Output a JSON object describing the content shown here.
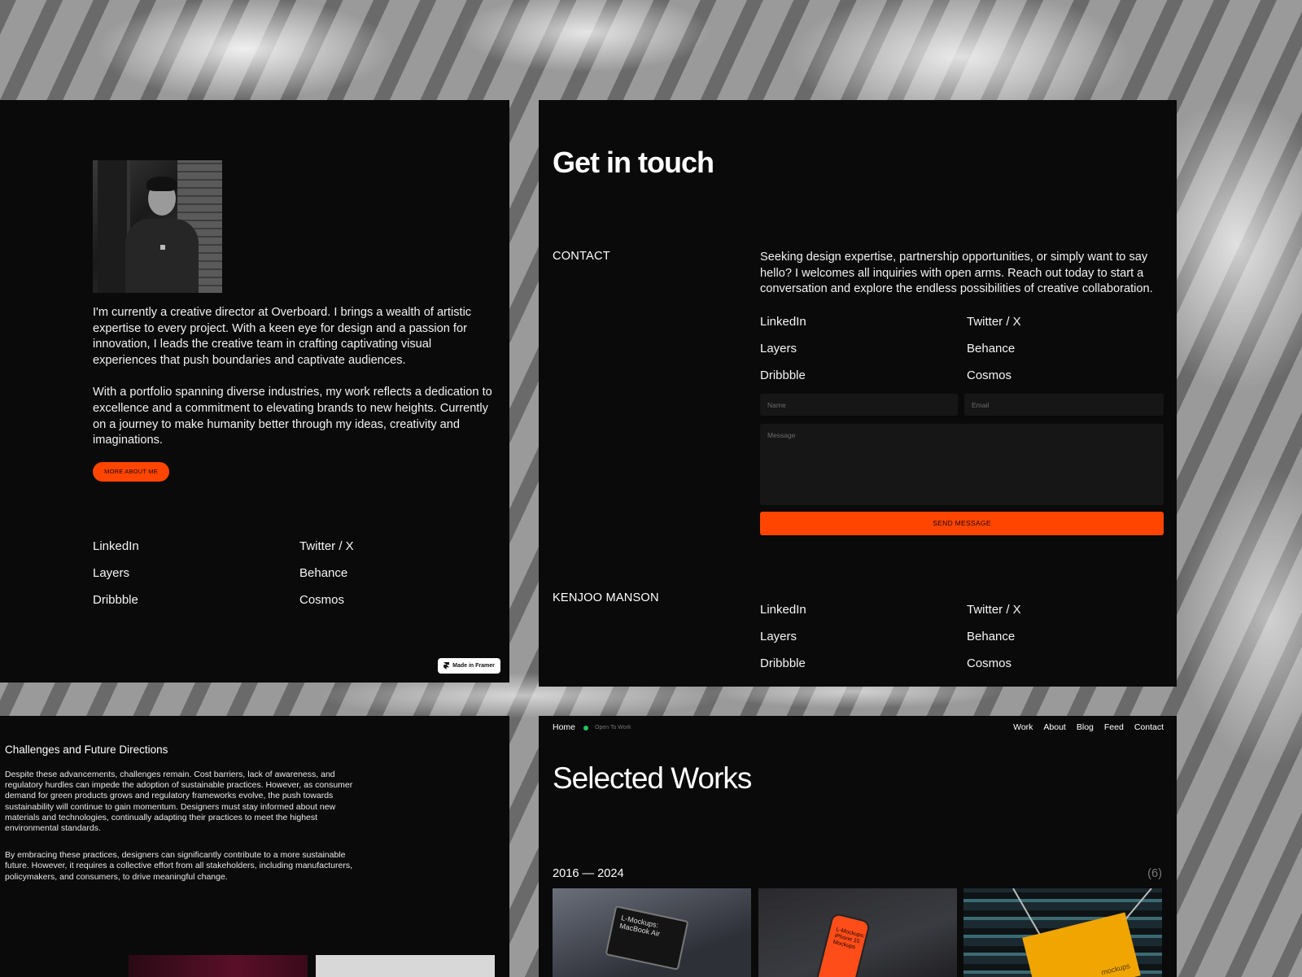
{
  "about": {
    "bio_p1": "I'm currently a creative director at Overboard. I brings a wealth of artistic expertise to every project. With a keen eye for design and a passion for innovation, I leads the creative team in crafting captivating visual experiences that push boundaries and captivate audiences.",
    "bio_p2": "With a portfolio spanning diverse industries, my work reflects a dedication to excellence and a commitment to elevating brands to new heights. Currently on a journey to make humanity better through my ideas, creativity and imaginations.",
    "more_button": "MORE ABOUT ME",
    "links": [
      "LinkedIn",
      "Twitter / X",
      "Layers",
      "Behance",
      "Dribbble",
      "Cosmos"
    ],
    "framer_badge": "Made in Framer"
  },
  "contact": {
    "title": "Get in touch",
    "section_label": "CONTACT",
    "intro": "Seeking design expertise, partnership opportunities, or simply want to say hello? I welcomes all inquiries with open arms. Reach out today to start a conversation and explore the endless possibilities of creative collaboration.",
    "links": [
      "LinkedIn",
      "Twitter / X",
      "Layers",
      "Behance",
      "Dribbble",
      "Cosmos"
    ],
    "form": {
      "name_placeholder": "Name",
      "email_placeholder": "Email",
      "message_placeholder": "Message",
      "send_button": "SEND MESSAGE"
    },
    "footer_name": "KENJOO MANSON",
    "footer_links": [
      "LinkedIn",
      "Twitter / X",
      "Layers",
      "Behance",
      "Dribbble",
      "Cosmos"
    ]
  },
  "article": {
    "heading": "Challenges and Future Directions",
    "p1": "Despite these advancements, challenges remain. Cost barriers, lack of awareness, and regulatory hurdles can impede the adoption of sustainable practices. However, as consumer demand for green products grows and regulatory frameworks evolve, the push towards sustainability will continue to gain momentum. Designers must stay informed about new materials and technologies, continually adapting their practices to meet the highest environmental standards.",
    "p2": "By embracing these practices, designers can significantly contribute to a more sustainable future. However, it requires a collective effort from all stakeholders, including manufacturers, policymakers, and consumers, to drive meaningful change."
  },
  "works": {
    "nav_home": "Home",
    "status": "Open To Work",
    "nav": [
      "Work",
      "About",
      "Blog",
      "Feed",
      "Contact"
    ],
    "title": "Selected Works",
    "years": "2016 — 2024",
    "count": "(6)",
    "cards": [
      {
        "caption": "L-Mockups: MacBook Air"
      },
      {
        "caption": "L-Mockups: iPhone 15 Mockups"
      },
      {
        "caption": "mockups"
      }
    ]
  },
  "colors": {
    "accent": "#ff4500",
    "panel": "#0a0a0a",
    "status_dot": "#22c55e"
  }
}
